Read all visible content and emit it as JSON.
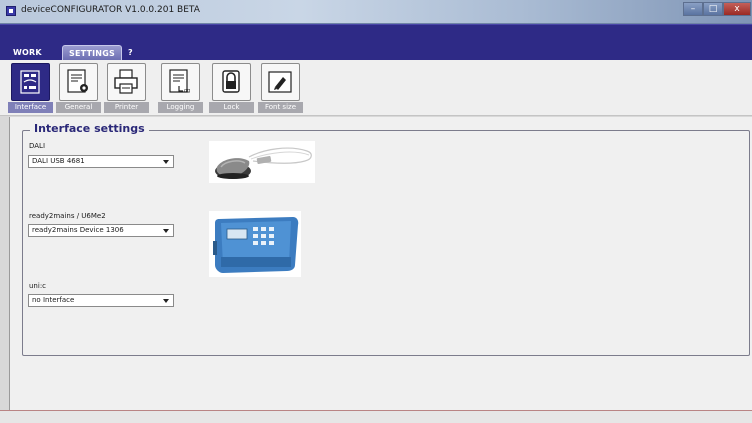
{
  "window": {
    "title": "deviceCONFIGURATOR V1.0.0.201 BETA",
    "minimize_label": "–",
    "maximize_label": "□",
    "close_label": "x"
  },
  "menu": {
    "tabs": [
      {
        "label": "WORK"
      },
      {
        "label": "SETTINGS"
      },
      {
        "label": "?"
      }
    ]
  },
  "toolbar": {
    "items": [
      {
        "label": "Interface",
        "icon": "interface-icon",
        "active": true
      },
      {
        "label": "General",
        "icon": "general-settings-icon",
        "active": false
      },
      {
        "label": "Printer",
        "icon": "printer-icon",
        "active": false
      },
      {
        "label": "Logging",
        "icon": "logging-icon",
        "active": false
      },
      {
        "label": "Lock",
        "icon": "lock-icon",
        "active": false
      },
      {
        "label": "Font size",
        "icon": "font-size-icon",
        "active": false
      }
    ]
  },
  "interface_settings": {
    "title": "Interface settings",
    "sections": [
      {
        "label": "DALI",
        "selected": "DALI USB 4681",
        "image": "dali-usb-device-image"
      },
      {
        "label": "ready2mains / U6Me2",
        "selected": "ready2mains Device 1306",
        "image": "ready2mains-device-image"
      },
      {
        "label": "uni:c",
        "selected": "no Interface"
      }
    ]
  },
  "colors": {
    "menu_band": "#2e2a86",
    "accent_title": "#2a2878",
    "tool_label_bg": "#a8a8ae"
  }
}
